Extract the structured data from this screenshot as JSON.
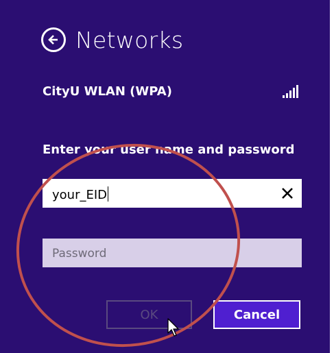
{
  "header": {
    "title": "Networks",
    "back_icon": "back-arrow-icon"
  },
  "network": {
    "name": "CityU WLAN (WPA)",
    "signal_icon": "wifi-signal-icon"
  },
  "form": {
    "prompt": "Enter your user name and password",
    "username_value": "your_EID",
    "password_placeholder": "Password"
  },
  "buttons": {
    "ok_label": "OK",
    "cancel_label": "Cancel"
  },
  "colors": {
    "background": "#2b0e72",
    "accent": "#4f1fd0",
    "annotation": "#c0504d"
  }
}
